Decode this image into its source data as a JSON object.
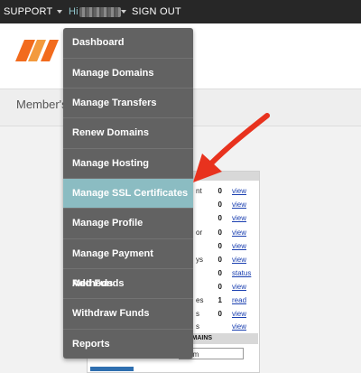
{
  "topnav": {
    "support_label": "SUPPORT",
    "greeting_label": "Hi",
    "signout_label": "SIGN OUT"
  },
  "subheader": {
    "members_label": "Member's"
  },
  "dropdown": {
    "items": [
      {
        "label": "Dashboard"
      },
      {
        "label": "Manage Domains"
      },
      {
        "label": "Manage Transfers"
      },
      {
        "label": "Renew Domains"
      },
      {
        "label": "Manage Hosting"
      },
      {
        "label": "Manage SSL Certificates",
        "active": true
      },
      {
        "label": "Manage Profile"
      },
      {
        "label": "Manage Payment Methods"
      },
      {
        "label": "Add Funds"
      },
      {
        "label": "Withdraw Funds"
      },
      {
        "label": "Reports"
      }
    ]
  },
  "summary": {
    "rows": [
      {
        "label": "nt",
        "count": "0",
        "link": "view"
      },
      {
        "label": "",
        "count": "0",
        "link": "view"
      },
      {
        "label": "",
        "count": "0",
        "link": "view"
      },
      {
        "label": "or",
        "count": "0",
        "link": "view"
      },
      {
        "label": "",
        "count": "0",
        "link": "view"
      },
      {
        "label": "ys",
        "count": "0",
        "link": "view"
      },
      {
        "label": "",
        "count": "0",
        "link": "status"
      },
      {
        "label": "",
        "count": "0",
        "link": "view"
      },
      {
        "label": "es",
        "count": "1",
        "link": "read"
      },
      {
        "label": "s",
        "count": "0",
        "link": "view"
      },
      {
        "label": "s",
        "count": "",
        "link": "view"
      }
    ],
    "domains_heading": "DOMAINS",
    "domain_value": ".com"
  },
  "colors": {
    "topbar": "#272727",
    "dropdown_bg": "#626262",
    "dropdown_active": "#8bbcc2",
    "annotation_arrow": "#e8321e",
    "logo_orange": "#f26b1d"
  }
}
